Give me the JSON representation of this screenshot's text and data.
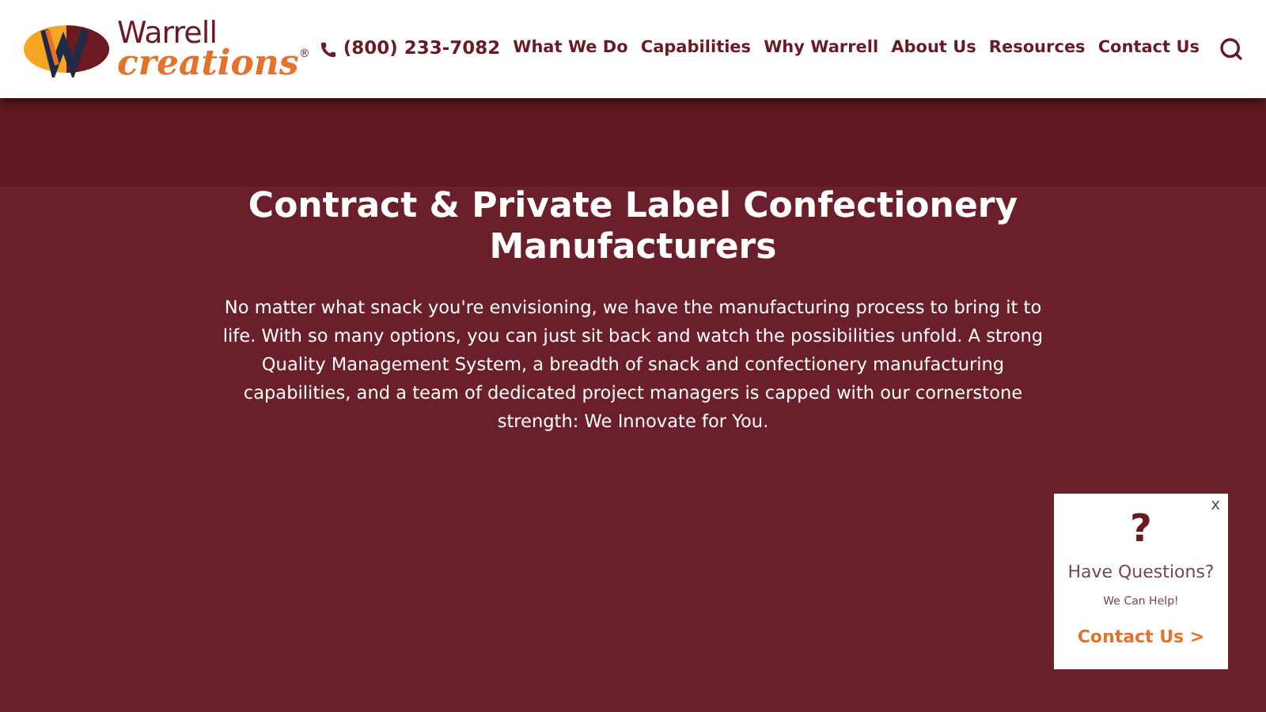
{
  "logo": {
    "line_1": "Warrell",
    "line_2": "creations",
    "mark": "®"
  },
  "phone": "(800) 233-7082",
  "nav": [
    "What We Do",
    "Capabilities",
    "Why Warrell",
    "About Us",
    "Resources",
    "Contact Us"
  ],
  "hero": {
    "title": "Contract & Private Label Confectionery Manufacturers",
    "text": "No matter what snack you're envisioning, we have the manufacturing process to bring it to life. With so many options, you can just sit back and watch the possibilities unfold. A strong Quality Management System, a breadth of snack and confectionery manufacturing capabilities, and a team of dedicated project managers is capped with our cornerstone strength: We Innovate for You."
  },
  "popup": {
    "close": "x",
    "symbol": "?",
    "title": "Have Questions?",
    "subtitle": "We Can Help!",
    "link": "Contact Us >"
  }
}
